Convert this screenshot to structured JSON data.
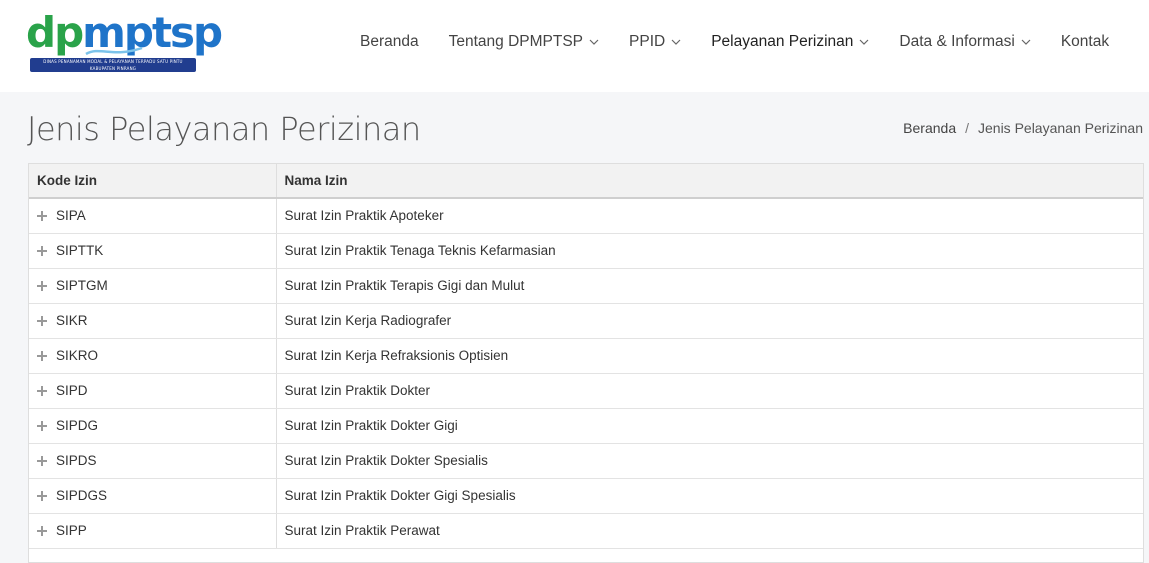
{
  "logo": {
    "word_green": "dp",
    "word_blue": "mptsp",
    "tagline_1": "DINAS PENANAMAN MODAL & PELAYANAN TERPADU SATU PINTU",
    "tagline_2": "KABUPATEN PINRANG"
  },
  "nav": {
    "items": [
      {
        "label": "Beranda",
        "has_dropdown": false
      },
      {
        "label": "Tentang DPMPTSP",
        "has_dropdown": true
      },
      {
        "label": "PPID",
        "has_dropdown": true
      },
      {
        "label": "Pelayanan Perizinan",
        "has_dropdown": true
      },
      {
        "label": "Data & Informasi",
        "has_dropdown": true
      },
      {
        "label": "Kontak",
        "has_dropdown": false
      }
    ]
  },
  "page": {
    "title": "Jenis Pelayanan Perizinan"
  },
  "breadcrumb": {
    "home": "Beranda",
    "separator": "/",
    "current": "Jenis Pelayanan Perizinan"
  },
  "table": {
    "headers": [
      "Kode Izin",
      "Nama Izin"
    ],
    "rows": [
      {
        "code": "SIPA",
        "name": "Surat Izin Praktik Apoteker"
      },
      {
        "code": "SIPTTK",
        "name": "Surat Izin Praktik Tenaga Teknis Kefarmasian"
      },
      {
        "code": "SIPTGM",
        "name": "Surat Izin Praktik Terapis Gigi dan Mulut"
      },
      {
        "code": "SIKR",
        "name": "Surat Izin Kerja Radiografer"
      },
      {
        "code": "SIKRO",
        "name": "Surat Izin Kerja Refraksionis Optisien"
      },
      {
        "code": "SIPD",
        "name": "Surat Izin Praktik Dokter"
      },
      {
        "code": "SIPDG",
        "name": "Surat Izin Praktik Dokter Gigi"
      },
      {
        "code": "SIPDS",
        "name": "Surat Izin Praktik Dokter Spesialis"
      },
      {
        "code": "SIPDGS",
        "name": "Surat Izin Praktik Dokter Gigi Spesialis"
      },
      {
        "code": "SIPP",
        "name": "Surat Izin Praktik Perawat"
      }
    ]
  },
  "colors": {
    "brand_green": "#2aa34a",
    "brand_blue": "#1f74c9",
    "brand_navy": "#213d8f"
  }
}
